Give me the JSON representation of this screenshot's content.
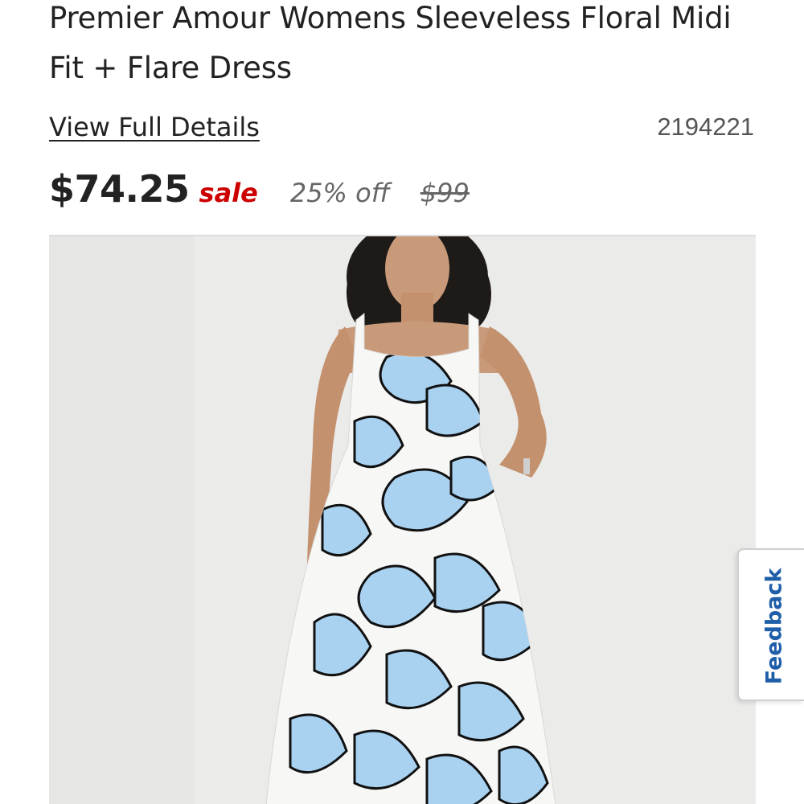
{
  "product": {
    "title": "Premier Amour Womens Sleeveless Floral Midi Fit + Flare Dress",
    "details_link": "View Full Details",
    "sku": "2194221",
    "image_alt": "Model wearing a sleeveless white midi dress with large light blue floral print"
  },
  "pricing": {
    "sale_price": "$74.25",
    "sale_label": "sale",
    "discount": "25% off",
    "original_price": "$99"
  },
  "feedback": {
    "label": "Feedback"
  },
  "colors": {
    "sale_red": "#cc0000",
    "feedback_blue": "#1f5ea8",
    "image_bg": "#ebebea",
    "petal_blue": "#a9d2f1"
  }
}
